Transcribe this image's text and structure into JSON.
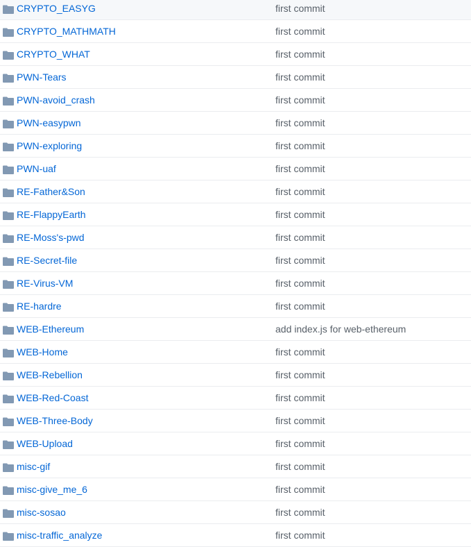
{
  "colors": {
    "link": "#0366d6",
    "message": "#586069",
    "folder": "#8299b3"
  },
  "files": [
    {
      "name": "CRYPTO_EASYG",
      "icon": "folder-icon",
      "message": "first commit"
    },
    {
      "name": "CRYPTO_MATHMATH",
      "icon": "folder-icon",
      "message": "first commit"
    },
    {
      "name": "CRYPTO_WHAT",
      "icon": "folder-icon",
      "message": "first commit"
    },
    {
      "name": "PWN-Tears",
      "icon": "folder-icon",
      "message": "first commit"
    },
    {
      "name": "PWN-avoid_crash",
      "icon": "folder-icon",
      "message": "first commit"
    },
    {
      "name": "PWN-easypwn",
      "icon": "folder-icon",
      "message": "first commit"
    },
    {
      "name": "PWN-exploring",
      "icon": "folder-icon",
      "message": "first commit"
    },
    {
      "name": "PWN-uaf",
      "icon": "folder-icon",
      "message": "first commit"
    },
    {
      "name": "RE-Father&Son",
      "icon": "folder-icon",
      "message": "first commit"
    },
    {
      "name": "RE-FlappyEarth",
      "icon": "folder-icon",
      "message": "first commit"
    },
    {
      "name": "RE-Moss's-pwd",
      "icon": "folder-icon",
      "message": "first commit"
    },
    {
      "name": "RE-Secret-file",
      "icon": "folder-icon",
      "message": "first commit"
    },
    {
      "name": "RE-Virus-VM",
      "icon": "folder-icon",
      "message": "first commit"
    },
    {
      "name": "RE-hardre",
      "icon": "folder-icon",
      "message": "first commit"
    },
    {
      "name": "WEB-Ethereum",
      "icon": "folder-icon",
      "message": "add index.js for web-ethereum"
    },
    {
      "name": "WEB-Home",
      "icon": "folder-icon",
      "message": "first commit"
    },
    {
      "name": "WEB-Rebellion",
      "icon": "folder-icon",
      "message": "first commit"
    },
    {
      "name": "WEB-Red-Coast",
      "icon": "folder-icon",
      "message": "first commit"
    },
    {
      "name": "WEB-Three-Body",
      "icon": "folder-icon",
      "message": "first commit"
    },
    {
      "name": "WEB-Upload",
      "icon": "folder-icon",
      "message": "first commit"
    },
    {
      "name": "misc-gif",
      "icon": "folder-icon",
      "message": "first commit"
    },
    {
      "name": "misc-give_me_6",
      "icon": "folder-icon",
      "message": "first commit"
    },
    {
      "name": "misc-sosao",
      "icon": "folder-icon",
      "message": "first commit"
    },
    {
      "name": "misc-traffic_analyze",
      "icon": "folder-icon",
      "message": "first commit"
    }
  ]
}
